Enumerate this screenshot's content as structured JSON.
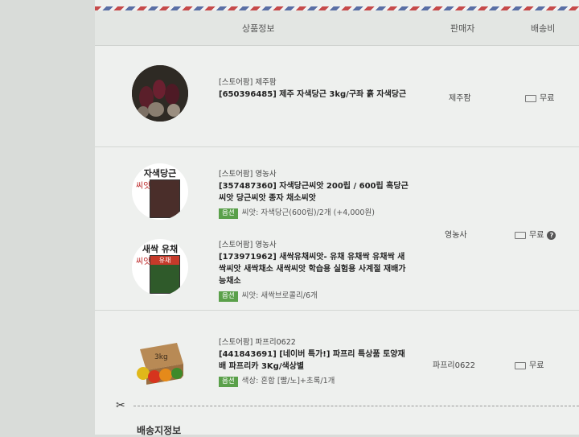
{
  "header": {
    "col_product": "상품정보",
    "col_seller": "판매자",
    "col_shipping": "배송비"
  },
  "items": [
    {
      "store": "[스토어팜] 제주팜",
      "title": "[650396485] 제주 자색당근 3kg/구좌 흙 자색당근",
      "option_tag": "",
      "option": "",
      "seller": "제주팜",
      "shipping": "무료"
    },
    {
      "store": "[스토어팜] 영농사",
      "title": "[357487360] 자색당근씨앗 200립 / 600립 흑당근씨앗 당근씨앗 종자 채소씨앗",
      "option_tag": "옵션",
      "option": "씨앗: 자색당근(600립)/2개 (+4,000원)",
      "seller": "영농사",
      "shipping": "무료",
      "help": "?"
    },
    {
      "store": "[스토어팜] 영농사",
      "title": "[173971962] 새싹유채씨앗- 유채 유채싹 유채싹 새싹씨앗 새싹채소 새싹씨앗 학습용 실험용 사계절 재배가능채소",
      "option_tag": "옵션",
      "option": "씨앗: 새싹브로콜리/6개",
      "seller": "",
      "shipping": ""
    },
    {
      "store": "[스토어팜] 파프리0622",
      "title": "[441843691] [네이버 특가!] 파프리 특상품 토양재배 파프리카 3Kg/색상별",
      "option_tag": "옵션",
      "option": "색상: 혼합 [빨/노]+초록/1개",
      "seller": "파프리0622",
      "shipping": "무료"
    }
  ],
  "thumbs": {
    "seed1_title": "자색당근",
    "seed1_side": "씨앗",
    "seed2_title": "새싹 유채",
    "seed2_side": "씨앗",
    "seed2_box": "유채",
    "box_label": "3kg"
  },
  "footer": {
    "section_title": "배송지정보"
  }
}
